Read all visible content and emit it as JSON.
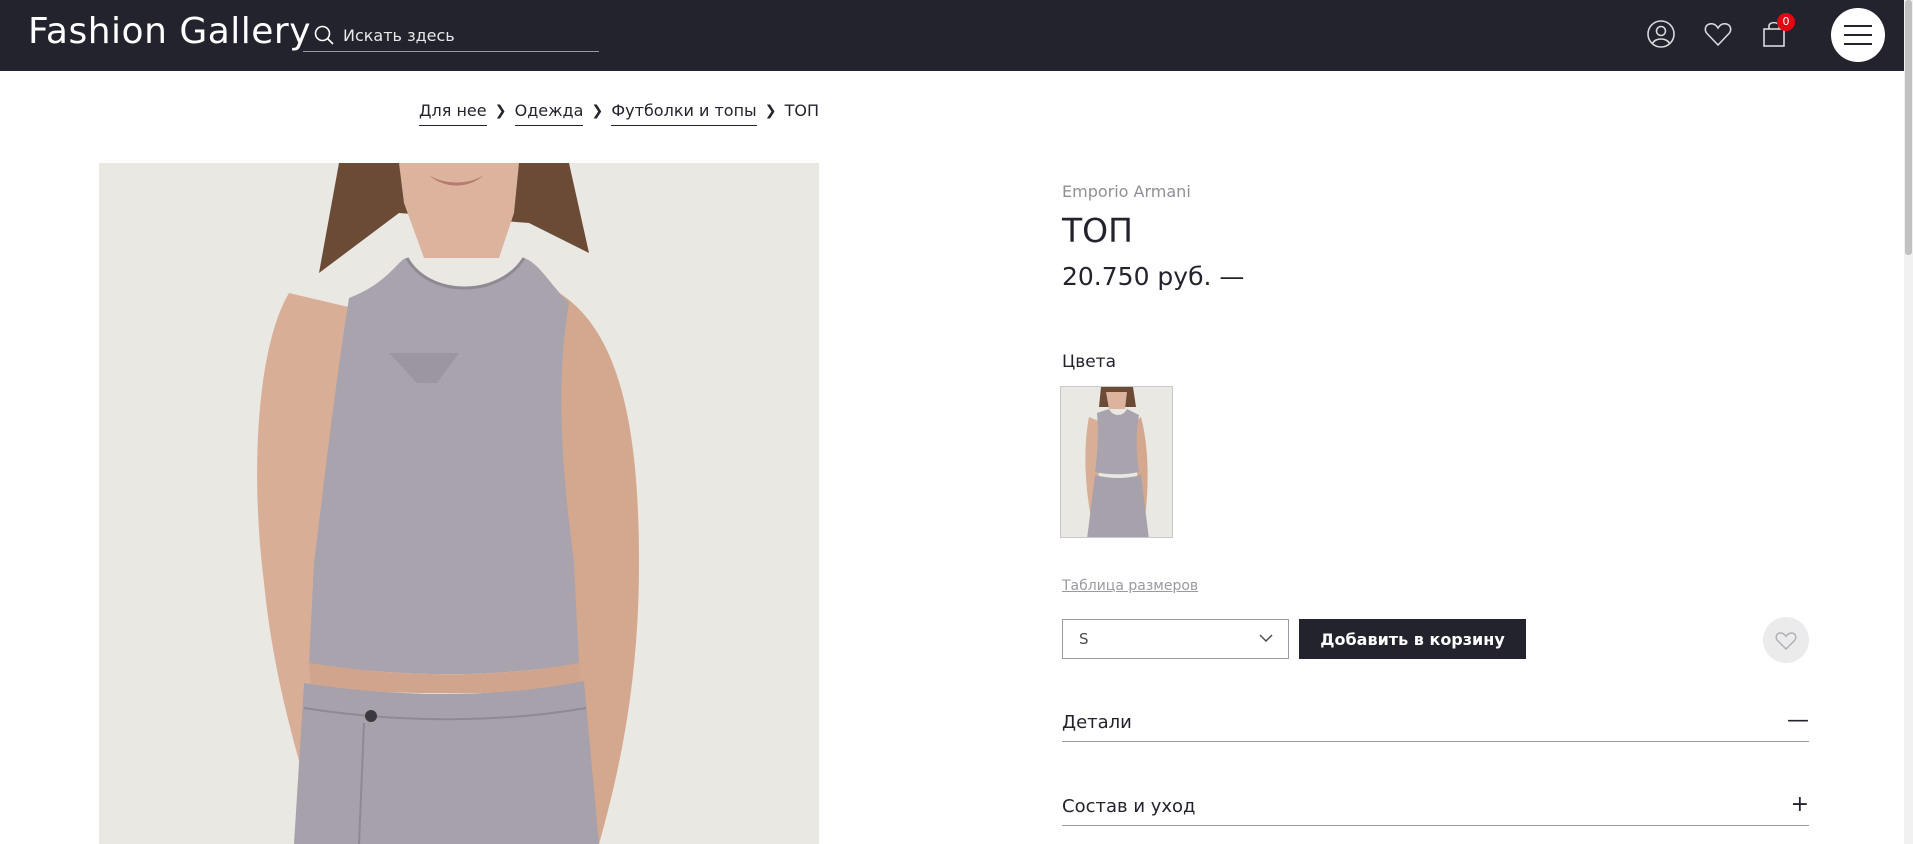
{
  "header": {
    "logo": "Fashion Gallery",
    "search_placeholder": "Искать здесь",
    "cart_count": "0"
  },
  "breadcrumb": {
    "items": [
      "Для нее",
      "Одежда",
      "Футболки и топы"
    ],
    "current": "ТОП"
  },
  "product": {
    "brand": "Emporio Armani",
    "title": "ТОП",
    "price": "20.750 руб. —",
    "colors_label": "Цвета",
    "size_table": "Таблица размеров",
    "selected_size": "S",
    "add_to_cart": "Добавить в корзину"
  },
  "accordions": [
    {
      "label": "Детали",
      "sign": "—"
    },
    {
      "label": "Состав и уход",
      "sign": "+"
    }
  ],
  "colors": {
    "header_bg": "#23232d",
    "badge": "#e30613",
    "garment": "#a9a3ad"
  },
  "icons": [
    "search-icon",
    "user-icon",
    "heart-icon",
    "cart-icon",
    "menu-icon",
    "chevron-down-icon",
    "chevron-right-icon"
  ]
}
